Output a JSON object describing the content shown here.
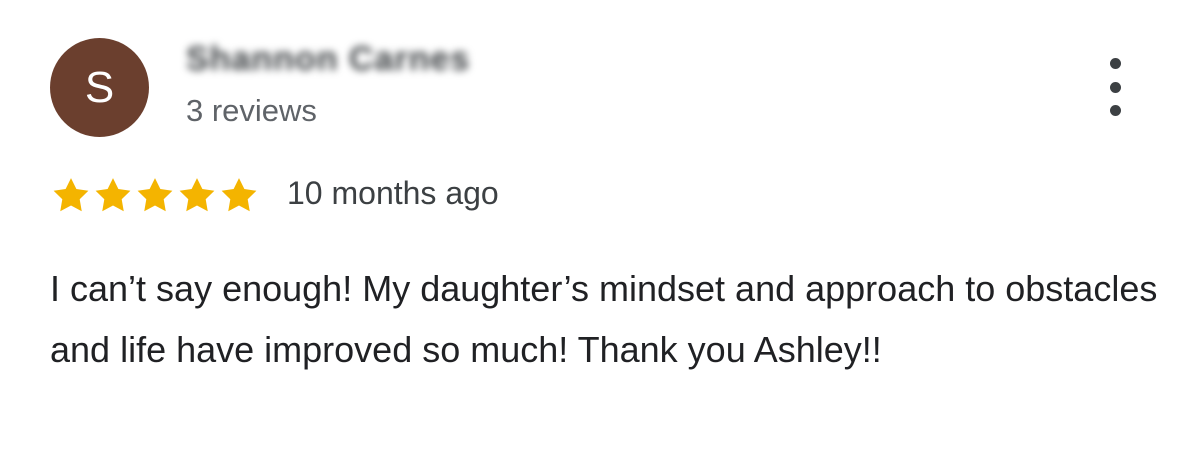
{
  "review": {
    "avatar_letter": "S",
    "avatar_color": "#6b3f2e",
    "reviewer_name": "Shannon Carnes",
    "review_count": "3 reviews",
    "rating": 5,
    "rating_max": 5,
    "star_color": "#f4b400",
    "date": "10 months ago",
    "text": "I can’t say enough! My daughter’s mindset and approach to obstacles and life have improved so much! Thank you Ashley!!"
  },
  "icons": {
    "menu": "more-vert-icon",
    "star": "star-icon"
  }
}
